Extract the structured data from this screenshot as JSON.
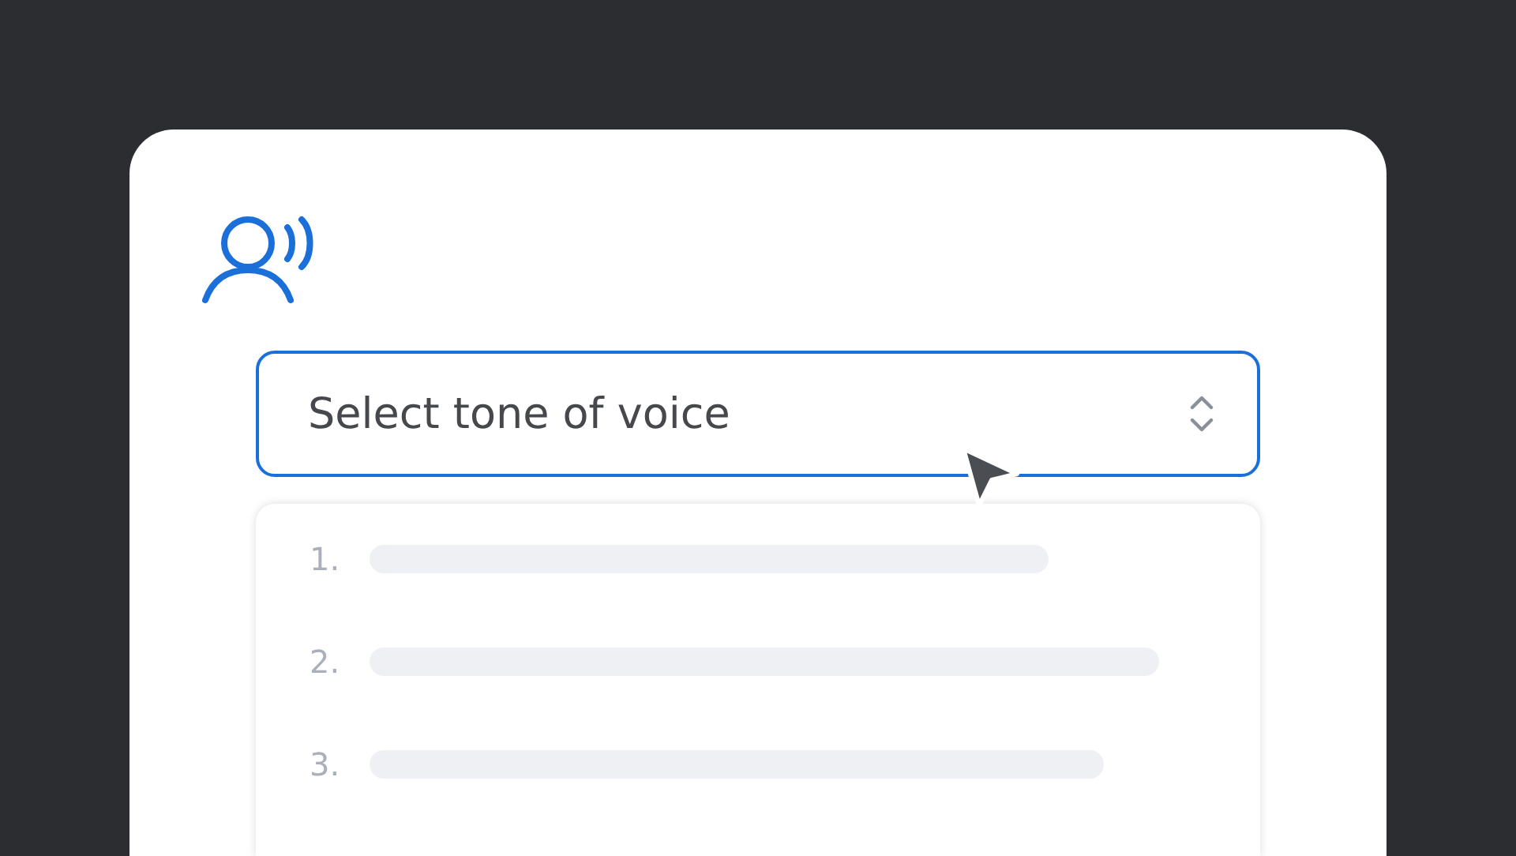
{
  "select": {
    "placeholder": "Select tone of voice"
  },
  "options": [
    {
      "number": "1."
    },
    {
      "number": "2."
    },
    {
      "number": "3."
    }
  ]
}
